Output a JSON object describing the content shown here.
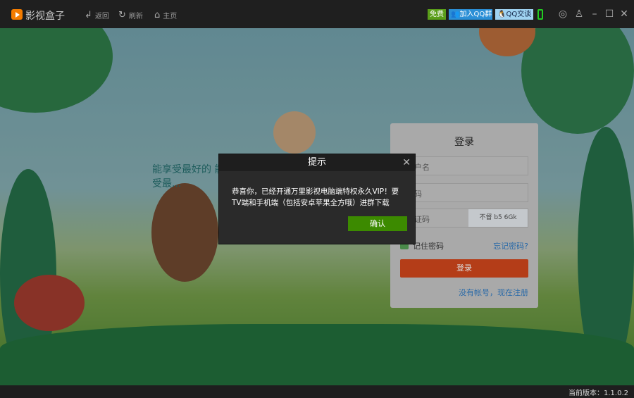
{
  "titlebar": {
    "app_name": "影视盒子",
    "back": "返回",
    "refresh": "刷新",
    "home": "主页",
    "free_badge": "免费",
    "join_qq_group": "加入QQ群",
    "qq_chat": "QQ交谈",
    "colors": {
      "free": "#5a9e1a",
      "qq": "#2b8fd6"
    }
  },
  "scene": {
    "slogan": "能享受最好的 能承受最...",
    "colors": {
      "sky": "#a6d7dd",
      "grass": "#8fc25a"
    }
  },
  "login": {
    "title": "登录",
    "username_placeholder": "用户名",
    "password_placeholder": "密码",
    "captcha_placeholder": "验证码",
    "captcha_text": "不督 b5 6Gk",
    "remember_password": "记住密码",
    "forgot_password": "忘记密码?",
    "login_button": "登录",
    "register_link": "没有帐号，现在注册",
    "colors": {
      "button": "#b43d18"
    }
  },
  "dialog": {
    "title": "提示",
    "message": "恭喜你，已经开通万里影视电脑端特权永久VIP！要TV端和手机端（包括安卓苹果全方哦）进群下载",
    "confirm": "确认",
    "colors": {
      "confirm": "#3c8a00"
    }
  },
  "status": {
    "version": "当前版本：1.1.0.2"
  }
}
